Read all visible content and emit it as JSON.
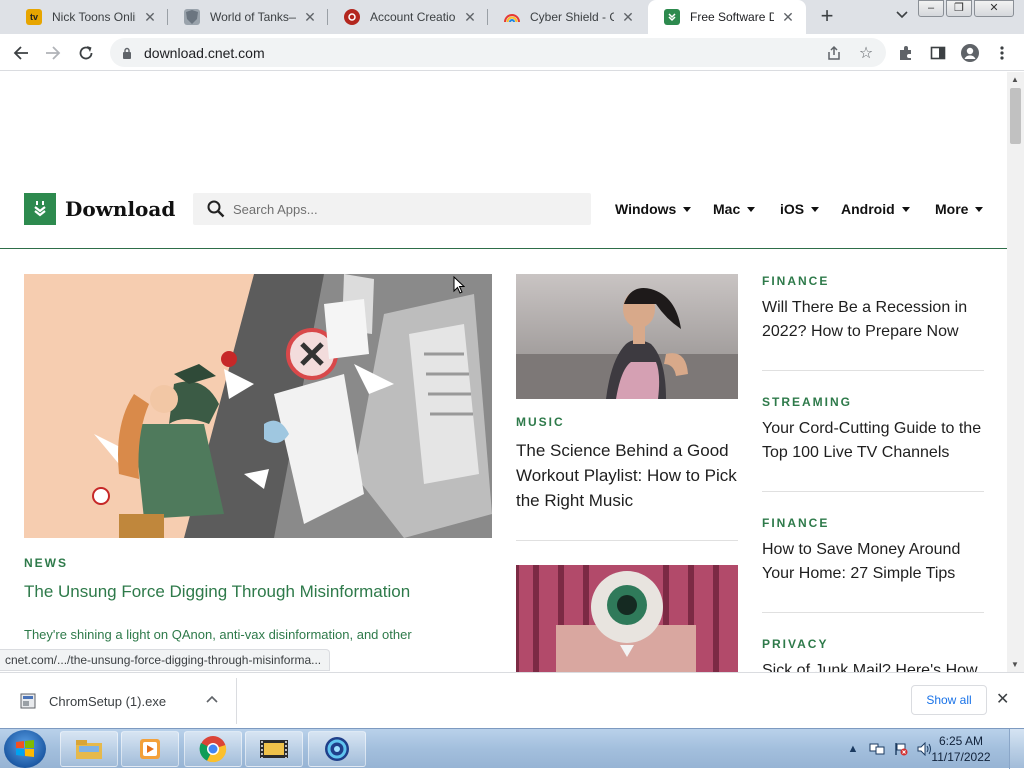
{
  "browser": {
    "tabs": [
      {
        "title": "Nick Toons Online"
      },
      {
        "title": "World of Tanks—F"
      },
      {
        "title": "Account Creation"
      },
      {
        "title": "Cyber Shield - Ch"
      },
      {
        "title": "Free Software Do",
        "active": true
      }
    ],
    "url": "download.cnet.com",
    "status_url": "cnet.com/.../the-unsung-force-digging-through-misinforma..."
  },
  "site": {
    "logo_text": "Download",
    "search_placeholder": "Search Apps...",
    "nav": [
      "Windows",
      "Mac",
      "iOS",
      "Android",
      "More"
    ],
    "feature": {
      "category": "NEWS",
      "title": "The Unsung Force Digging Through Misinformation",
      "description": "They're shining a light on QAnon, anti-vax disinformation, and other"
    },
    "middle": [
      {
        "category": "MUSIC",
        "title": "The Science Behind a Good Workout Playlist: How to Pick the Right Music"
      }
    ],
    "sidebar": [
      {
        "category": "FINANCE",
        "title": "Will There Be a Recession in 2022? How to Prepare Now"
      },
      {
        "category": "STREAMING",
        "title": "Your Cord-Cutting Guide to the Top 100 Live TV Channels"
      },
      {
        "category": "FINANCE",
        "title": "How to Save Money Around Your Home: 27 Simple Tips"
      },
      {
        "category": "PRIVACY",
        "title": "Sick of Junk Mail? Here's How"
      }
    ]
  },
  "downloads": {
    "file_name": "ChromSetup (1).exe",
    "show_all": "Show all"
  },
  "taskbar": {
    "time": "6:25 AM",
    "date": "11/17/2022"
  },
  "colors": {
    "accent_green": "#2e7a4a",
    "logo_green": "#2d8a4e",
    "link_blue": "#1a73e8"
  }
}
